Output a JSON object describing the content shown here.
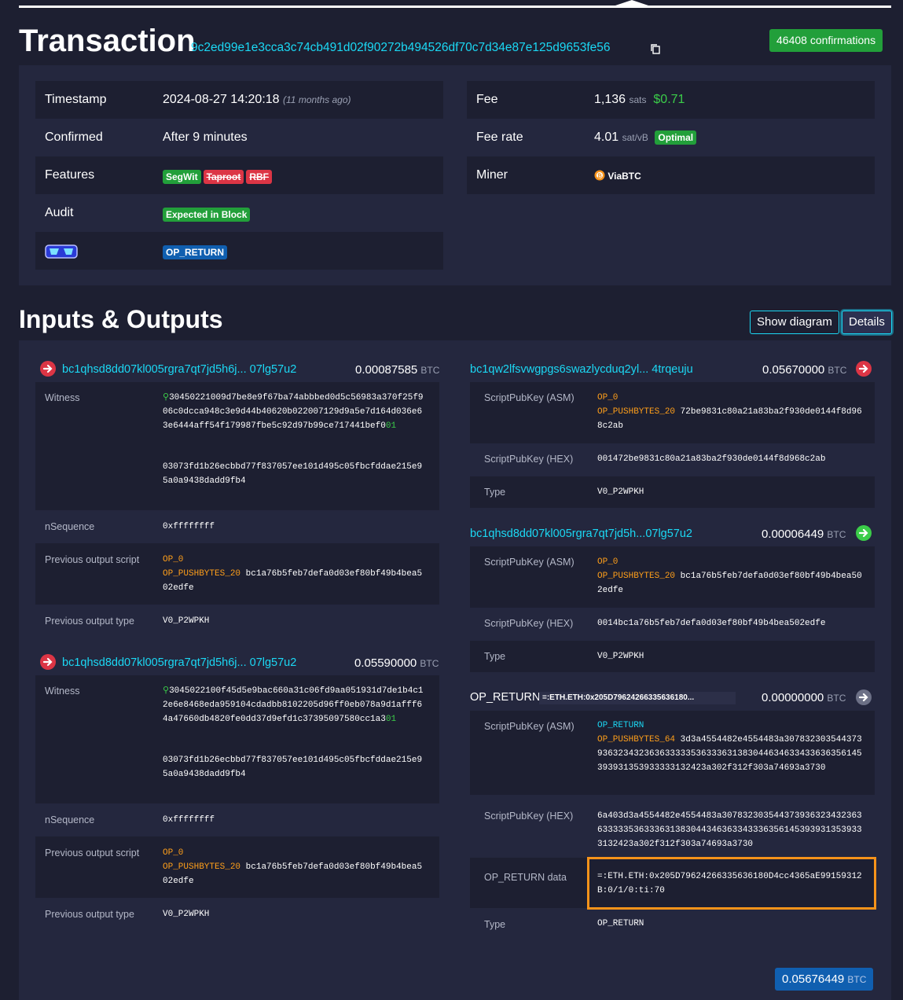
{
  "header": {
    "title": "Transaction",
    "txid": "9c2ed99e1e3cca3c74cb491d02f90272b494526df70c7d34e87e125d9653fe56",
    "confirmations": "46408 confirmations"
  },
  "details": {
    "timestamp_label": "Timestamp",
    "timestamp_value": "2024-08-27 14:20:18",
    "timestamp_ago": "(11 months ago)",
    "confirmed_label": "Confirmed",
    "confirmed_value": "After 9 minutes",
    "features_label": "Features",
    "features": [
      "SegWit",
      "Taproot",
      "RBF"
    ],
    "audit_label": "Audit",
    "audit_value": "Expected in Block",
    "op_return_badge": "OP_RETURN",
    "fee_label": "Fee",
    "fee_sats": "1,136",
    "fee_unit": "sats",
    "fee_usd": "$0.71",
    "fee_rate_label": "Fee rate",
    "fee_rate_value": "4.01",
    "fee_rate_unit": "sat/vB",
    "fee_rate_badge": "Optimal",
    "miner_label": "Miner",
    "miner_value": "ViaBTC"
  },
  "io": {
    "title": "Inputs & Outputs",
    "show_diagram": "Show diagram",
    "details_btn": "Details",
    "unit": "BTC",
    "inputs": [
      {
        "address": "bc1qhsd8dd07kl005rgra7qt7jd5h6j... 07lg57u2",
        "amount": "0.00087585",
        "witness_label": "Witness",
        "witness_1a": "30450221009d7be8e9f67ba74abbbed0d5c56983a370f25f906c0dcca948c3e9d44b40620b022007129d9a5e7d164d036e63e6444aff54f179987fbe5c92d97b99ce7174",
        "witness_1b": "41bef0",
        "witness_1c": "01",
        "witness_2": "03073fd1b26ecbbd77f837057ee101d495c05fbcfddae215e95a0a9438dadd9fb4",
        "nsequence_label": "nSequence",
        "nsequence": "0xffffffff",
        "prevscript_label": "Previous output script",
        "op0": "OP_0",
        "op_push": "OP_PUSHBYTES_20",
        "prevscript_hex": "bc1a76b5feb7defa0d03ef80bf49b4bea502edfe",
        "prevtype_label": "Previous output type",
        "prevtype": "V0_P2WPKH"
      },
      {
        "address": "bc1qhsd8dd07kl005rgra7qt7jd5h6j... 07lg57u2",
        "amount": "0.05590000",
        "witness_label": "Witness",
        "witness_1a": "3045022100f45d5e9bac660a31c06fd9aa051931d7de1b4c12e6e8468eda959104cdadbb8102205d96ff0eb078a9d1afff64a47660db4820fe0dd37d9efd1c3739509758",
        "witness_1b": "0cc1a3",
        "witness_1c": "01",
        "witness_2": "03073fd1b26ecbbd77f837057ee101d495c05fbcfddae215e95a0a9438dadd9fb4",
        "nsequence_label": "nSequence",
        "nsequence": "0xffffffff",
        "prevscript_label": "Previous output script",
        "op0": "OP_0",
        "op_push": "OP_PUSHBYTES_20",
        "prevscript_hex": "bc1a76b5feb7defa0d03ef80bf49b4bea502edfe",
        "prevtype_label": "Previous output type",
        "prevtype": "V0_P2WPKH"
      }
    ],
    "outputs": [
      {
        "address": "bc1qw2lfsvwgpgs6swazlycduq2yl... 4trqeuju",
        "amount": "0.05670000",
        "asm_label": "ScriptPubKey (ASM)",
        "op0": "OP_0",
        "op_push": "OP_PUSHBYTES_20",
        "asm_hex": "72be9831c80a21a83ba2f930de0144f8d968c2ab",
        "hex_label": "ScriptPubKey (HEX)",
        "hex": "001472be9831c80a21a83ba2f930de0144f8d968c2ab",
        "type_label": "Type",
        "type": "V0_P2WPKH"
      },
      {
        "address": "bc1qhsd8dd07kl005rgra7qt7jd5h...07lg57u2",
        "amount": "0.00006449",
        "asm_label": "ScriptPubKey (ASM)",
        "op0": "OP_0",
        "op_push": "OP_PUSHBYTES_20",
        "asm_hex": "bc1a76b5feb7defa0d03ef80bf49b4bea502edfe",
        "hex_label": "ScriptPubKey (HEX)",
        "hex": "0014bc1a76b5feb7defa0d03ef80bf49b4bea502edfe",
        "type_label": "Type",
        "type": "V0_P2WPKH"
      },
      {
        "title": "OP_RETURN",
        "tag": "=:ETH.ETH:0x205D79624266335636180...",
        "amount": "0.00000000",
        "asm_label": "ScriptPubKey (ASM)",
        "op_return": "OP_RETURN",
        "op_push": "OP_PUSHBYTES_64",
        "asm_hex": "3d3a4554482e4554483a307832303544373936323432363633333536333631383044634633433636356145393931353933333132423a302f312f303a74693a3730",
        "hex_label": "ScriptPubKey (HEX)",
        "hex": "6a403d3a4554482e4554483a3078323035443739363234323636333335363336313830443463633433363561453939313539333132423a302f312f303a74693a3730",
        "data_label": "OP_RETURN data",
        "data": "=:ETH.ETH:0x205D79624266335636180D4cc4365aE99159312B:0/1/0:ti:70",
        "type_label": "Type",
        "type": "OP_RETURN"
      }
    ],
    "total": "0.05676449"
  },
  "colors": {
    "accent": "#1bd8f4",
    "green": "#229f3a",
    "red": "#dc3545",
    "blue": "#105fb0",
    "orange": "#f7931a"
  }
}
